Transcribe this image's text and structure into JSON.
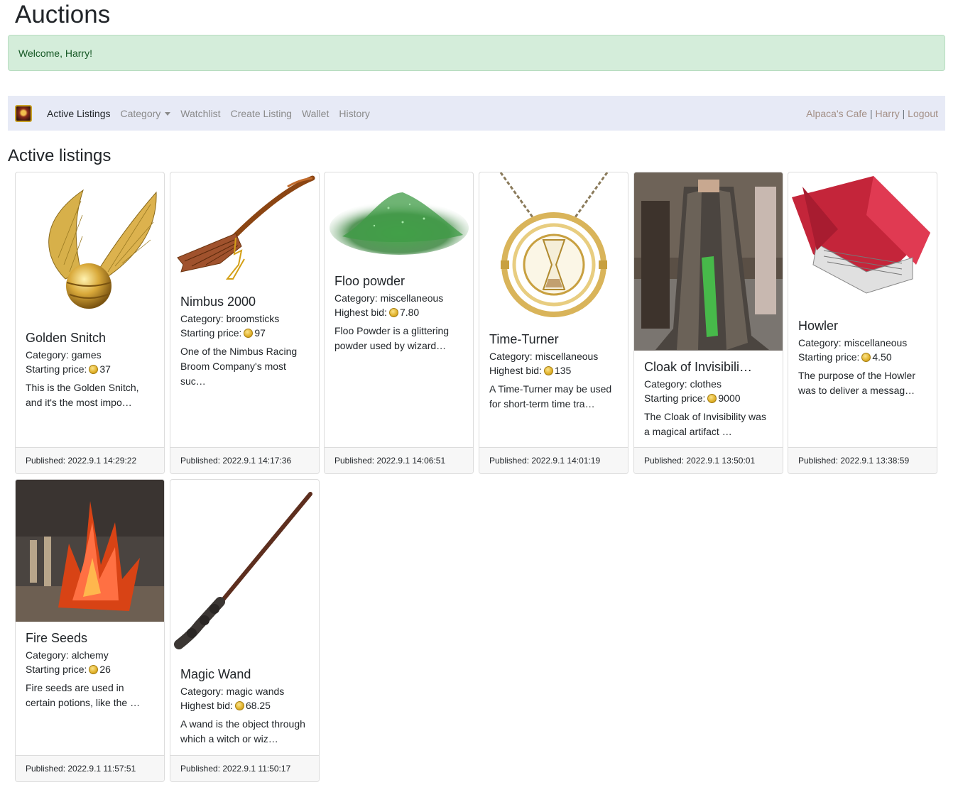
{
  "page": {
    "title": "Auctions"
  },
  "alert": {
    "text": "Welcome, Harry!",
    "color": "#155724"
  },
  "navbar": {
    "brand_icon": "auction-house-logo",
    "links": [
      "Active Listings",
      "Category",
      "Watchlist",
      "Create Listing",
      "Wallet",
      "History"
    ],
    "user": {
      "cafe": "Alpaca's Cafe",
      "sep": "|",
      "name": "Harry",
      "logout": "Logout"
    }
  },
  "section": {
    "title": "Active listings"
  },
  "currency_icon": "coin-icon",
  "listings": [
    {
      "title": "Golden Snitch",
      "category": "Category: games",
      "price_label": "Starting price:",
      "price": "37",
      "description": "This is the Golden Snitch, and it's the most impo…",
      "published": "Published: 2022.9.1 14:29:22",
      "image": "golden-snitch"
    },
    {
      "title": "Nimbus 2000",
      "category": "Category: broomsticks",
      "price_label": "Starting price:",
      "price": "97",
      "description": "One of the Nimbus Racing Broom Company's most suc…",
      "published": "Published: 2022.9.1 14:17:36",
      "image": "broomstick"
    },
    {
      "title": "Floo powder",
      "category": "Category: miscellaneous",
      "price_label": "Highest bid:",
      "price": "7.80",
      "description": "Floo Powder is a glittering powder used by wizard…",
      "published": "Published: 2022.9.1 14:06:51",
      "image": "green-powder"
    },
    {
      "title": "Time-Turner",
      "category": "Category: miscellaneous",
      "price_label": "Highest bid:",
      "price": "135",
      "description": "A Time-Turner may be used for short-term time tra…",
      "published": "Published: 2022.9.1 14:01:19",
      "image": "hourglass-necklace"
    },
    {
      "title": "Cloak of Invisibili…",
      "category": "Category: clothes",
      "price_label": "Starting price:",
      "price": "9000",
      "description": "The Cloak of Invisibility was a magical artifact …",
      "published": "Published: 2022.9.1 13:50:01",
      "image": "cloak"
    },
    {
      "title": "Howler",
      "category": "Category: miscellaneous",
      "price_label": "Starting price:",
      "price": "4.50",
      "description": "The purpose of the Howler was to deliver a messag…",
      "published": "Published: 2022.9.1 13:38:59",
      "image": "red-letter"
    },
    {
      "title": "Fire Seeds",
      "category": "Category: alchemy",
      "price_label": "Starting price:",
      "price": "26",
      "description": "Fire seeds are used in certain potions, like the …",
      "published": "Published: 2022.9.1 11:57:51",
      "image": "fire-crystal"
    },
    {
      "title": "Magic Wand",
      "category": "Category: magic wands",
      "price_label": "Highest bid:",
      "price": "68.25",
      "description": "A wand is the object through which a witch or wiz…",
      "published": "Published: 2022.9.1 11:50:17",
      "image": "wand"
    }
  ]
}
